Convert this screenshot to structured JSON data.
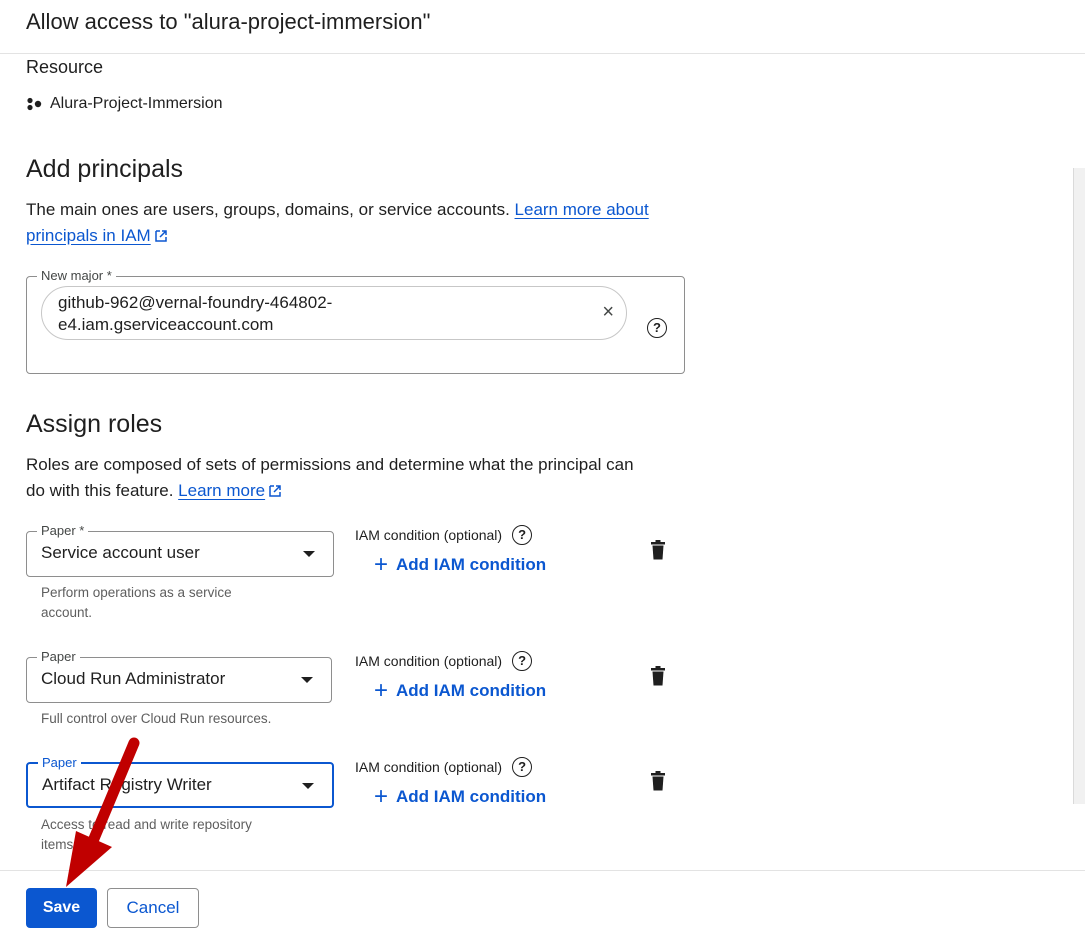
{
  "header": {
    "title": "Allow access to \"alura-project-immersion\""
  },
  "resource": {
    "label": "Resource",
    "name": "Alura-Project-Immersion",
    "icon": "project-icon"
  },
  "principals": {
    "heading": "Add principals",
    "description": "The main ones are users, groups, domains, or service accounts.",
    "link_line1": "Learn more about",
    "link_line2": "principals in IAM",
    "field_label": "New major *",
    "chip_value_line1": "github-962@vernal-foundry-464802-",
    "chip_value_line2": "e4.iam.gserviceaccount.com",
    "chip_close": "×",
    "help": "?"
  },
  "roles": {
    "heading": "Assign roles",
    "description_line1": "Roles are composed of sets of permissions and determine what the principal can",
    "description_line2": "do with this feature.",
    "learn_more": "Learn more",
    "items": [
      {
        "label": "Paper *",
        "value": "Service account user",
        "desc": "Perform operations as a service account.",
        "iam_label": "IAM condition (optional)",
        "add_iam": "Add IAM condition"
      },
      {
        "label": "Paper",
        "value": "Cloud Run Administrator",
        "desc": "Full control over Cloud Run resources.",
        "iam_label": "IAM condition (optional)",
        "add_iam": "Add IAM condition"
      },
      {
        "label": "Paper",
        "value": "Artifact Registry Writer",
        "desc": "Access to read and write repository items.",
        "iam_label": "IAM condition (optional)",
        "add_iam": "Add IAM condition"
      }
    ]
  },
  "footer": {
    "save_label": "Save",
    "cancel_label": "Cancel"
  },
  "colors": {
    "accent": "#0b57d0",
    "arrow": "#c00000"
  }
}
